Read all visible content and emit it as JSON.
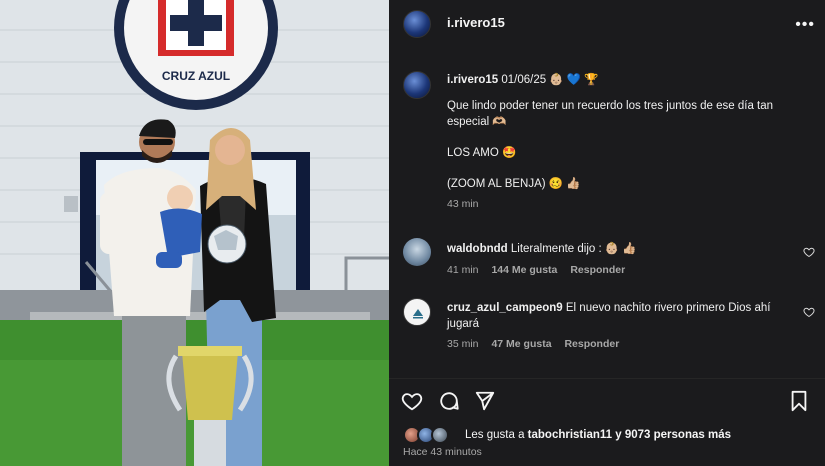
{
  "post": {
    "username": "i.rivero15",
    "more_icon": "more-horizontal-icon",
    "photo_sign_text": "CRUZ AZUL"
  },
  "caption": {
    "username": "i.rivero15",
    "line1": "01/06/25 👶🏼 💙 🏆",
    "line2": "Que lindo poder tener un recuerdo los tres juntos de ese día tan especial 🫶🏼",
    "line3": "LOS AMO 🤩",
    "line4": "(ZOOM AL BENJA) 🥴 👍🏼",
    "time": "43 min"
  },
  "comments": [
    {
      "username": "waldobndd",
      "text": "Literalmente dijo : 👶🏼 👍🏼",
      "time": "41 min",
      "likes": "144 Me gusta",
      "reply": "Responder"
    },
    {
      "username": "cruz_azul_campeon9",
      "text": "El nuevo nachito rivero primero Dios ahí jugará",
      "time": "35 min",
      "likes": "47 Me gusta",
      "reply": "Responder"
    }
  ],
  "likes": {
    "prefix": "Les gusta a",
    "user": "tabochristian11",
    "middle": "y",
    "count": "9073 personas más"
  },
  "posted": "Hace 43 minutos",
  "colors": {
    "panel_bg": "#1b1b1d",
    "muted_text": "#a8a8a8",
    "cruz_azul_red": "#d52b2b",
    "cruz_azul_navy": "#1c2a4a"
  }
}
